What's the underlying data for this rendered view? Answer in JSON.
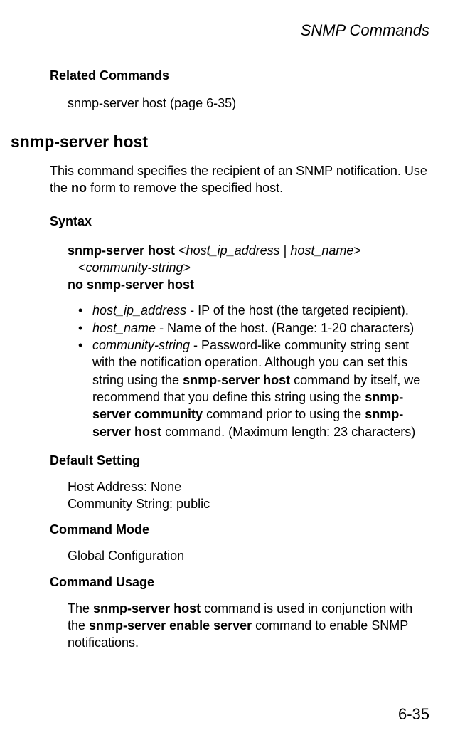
{
  "header": {
    "title": "SNMP Commands"
  },
  "related": {
    "heading": "Related Commands",
    "text": "snmp-server host (page 6-35)"
  },
  "command": {
    "heading": "snmp-server host",
    "description_part1": "This command specifies the recipient of an SNMP notification. Use the ",
    "description_bold": "no",
    "description_part2": " form to remove the specified host."
  },
  "syntax": {
    "heading": "Syntax",
    "line1_bold": "snmp-server host ",
    "line1_rest": "<",
    "line1_italic1": "host_ip_address",
    "line1_pipe": " | ",
    "line1_italic2": "host_name",
    "line1_close": ">",
    "line2_open": "<",
    "line2_italic": "community-string",
    "line2_close": ">",
    "line3": "no snmp-server host"
  },
  "bullets": {
    "b1_italic": "host_ip_address",
    "b1_text": " - IP of the host (the targeted recipient).",
    "b2_italic": "host_name",
    "b2_text": " - Name of the host. (Range: 1-20 characters)",
    "b3_italic": "community-string",
    "b3_text1": " - Password-like community string sent with the notification operation. Although you can set this string using the ",
    "b3_bold1": "snmp-server host",
    "b3_text2": " command by itself, we recommend that you define this string using the ",
    "b3_bold2": "snmp-server community",
    "b3_text3": " command prior to using the ",
    "b3_bold3": "snmp-server host",
    "b3_text4": " command. (Maximum length: 23 characters)"
  },
  "default": {
    "heading": "Default Setting",
    "line1": "Host Address: None",
    "line2": "Community String: public"
  },
  "mode": {
    "heading": "Command Mode",
    "text": "Global Configuration"
  },
  "usage": {
    "heading": "Command Usage",
    "text1": "The ",
    "bold1": "snmp-server host",
    "text2": " command is used in conjunction with the ",
    "bold2": "snmp-server enable server",
    "text3": " command to enable SNMP notifications."
  },
  "page_number": "6-35"
}
